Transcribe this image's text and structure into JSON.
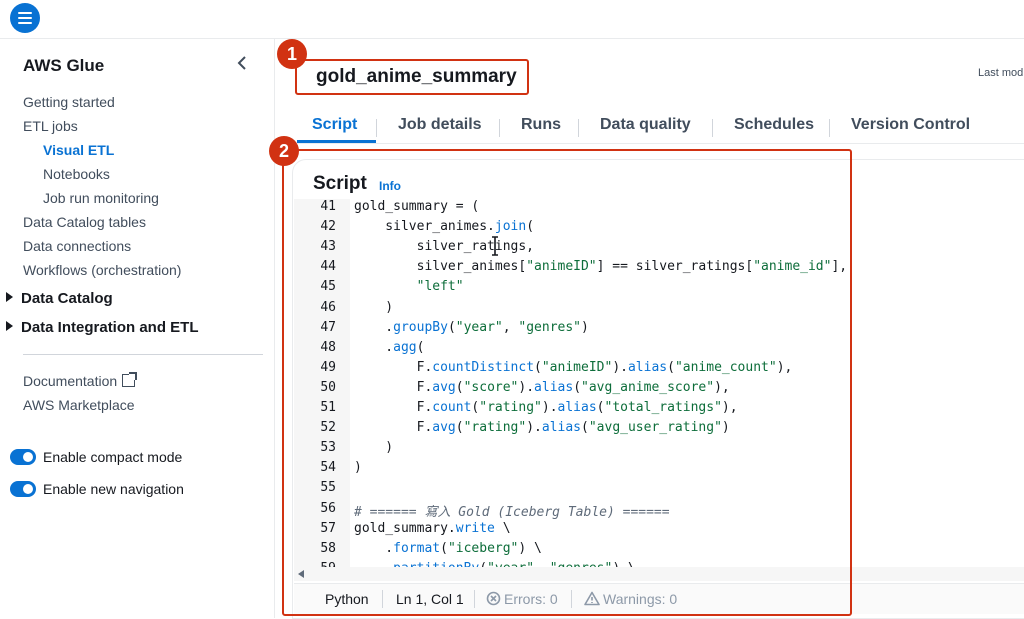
{
  "topbar": {
    "menu_icon": "hamburger-menu-icon"
  },
  "sidebar": {
    "title": "AWS Glue",
    "items": [
      {
        "label": "Getting started"
      },
      {
        "label": "ETL jobs"
      },
      {
        "label": "Visual ETL"
      },
      {
        "label": "Notebooks"
      },
      {
        "label": "Job run monitoring"
      },
      {
        "label": "Data Catalog tables"
      },
      {
        "label": "Data connections"
      },
      {
        "label": "Workflows (orchestration)"
      }
    ],
    "sections": [
      {
        "label": "Data Catalog"
      },
      {
        "label": "Data Integration and ETL"
      }
    ],
    "links": [
      {
        "label": "Documentation"
      },
      {
        "label": "AWS Marketplace"
      }
    ],
    "toggles": [
      {
        "label": "Enable compact mode",
        "on": true
      },
      {
        "label": "Enable new navigation",
        "on": true
      }
    ]
  },
  "job": {
    "name": "gold_anime_summary",
    "last_modified_label": "Last mod"
  },
  "callouts": [
    "1",
    "2"
  ],
  "tabs": [
    {
      "label": "Script",
      "active": true
    },
    {
      "label": "Job details"
    },
    {
      "label": "Runs"
    },
    {
      "label": "Data quality"
    },
    {
      "label": "Schedules"
    },
    {
      "label": "Version Control"
    }
  ],
  "script": {
    "heading": "Script",
    "info_label": "Info",
    "lines": [
      {
        "n": "41",
        "text": "gold_summary = ("
      },
      {
        "n": "42",
        "text": "    silver_animes.join("
      },
      {
        "n": "43",
        "text": "        silver_ratings,"
      },
      {
        "n": "44",
        "text": "        silver_animes[\"animeID\"] == silver_ratings[\"anime_id\"],"
      },
      {
        "n": "45",
        "text": "        \"left\""
      },
      {
        "n": "46",
        "text": "    )"
      },
      {
        "n": "47",
        "text": "    .groupBy(\"year\", \"genres\")"
      },
      {
        "n": "48",
        "text": "    .agg("
      },
      {
        "n": "49",
        "text": "        F.countDistinct(\"animeID\").alias(\"anime_count\"),"
      },
      {
        "n": "50",
        "text": "        F.avg(\"score\").alias(\"avg_anime_score\"),"
      },
      {
        "n": "51",
        "text": "        F.count(\"rating\").alias(\"total_ratings\"),"
      },
      {
        "n": "52",
        "text": "        F.avg(\"rating\").alias(\"avg_user_rating\")"
      },
      {
        "n": "53",
        "text": "    )"
      },
      {
        "n": "54",
        "text": ")"
      },
      {
        "n": "55",
        "text": ""
      },
      {
        "n": "56",
        "text": "# ====== 寫入 Gold (Iceberg Table) ======"
      },
      {
        "n": "57",
        "text": "gold_summary.write \\"
      },
      {
        "n": "58",
        "text": "    .format(\"iceberg\") \\"
      },
      {
        "n": "59",
        "text": "    .partitionBy(\"year\", \"genres\") \\"
      }
    ]
  },
  "status": {
    "language": "Python",
    "position": "Ln 1, Col 1",
    "errors": "Errors: 0",
    "warnings": "Warnings: 0"
  },
  "colors": {
    "accent": "#0972d3",
    "callout": "#d13212"
  }
}
